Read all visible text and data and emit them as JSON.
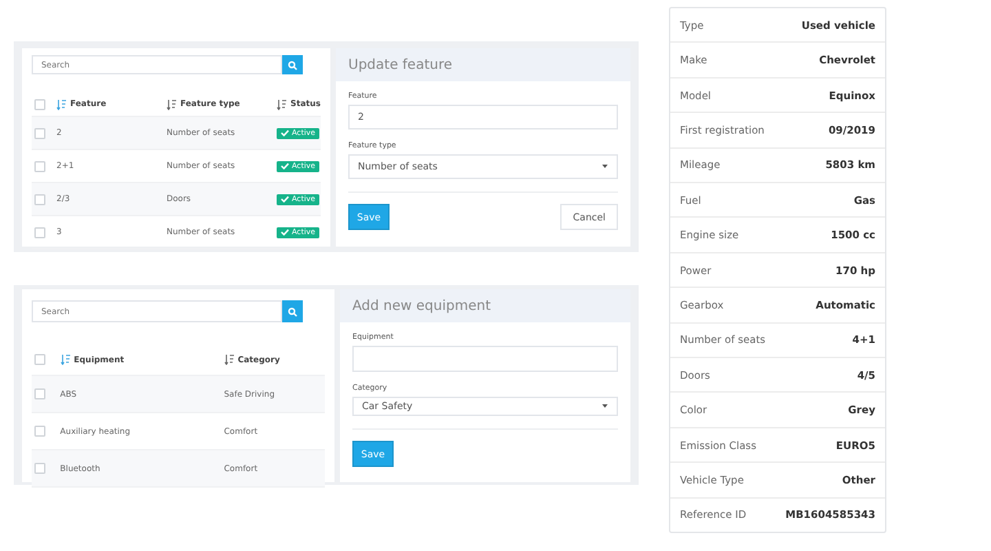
{
  "feature_panel": {
    "search": {
      "placeholder": "Search"
    },
    "select_all": {
      "checked": false
    },
    "columns": [
      {
        "label": "Feature",
        "sorted": true
      },
      {
        "label": "Feature type",
        "sorted": false
      },
      {
        "label": "Status",
        "sorted": false
      }
    ],
    "rows": [
      {
        "checked": false,
        "cells": [
          "2",
          "Number of seats"
        ],
        "status": "Active"
      },
      {
        "checked": false,
        "cells": [
          "2+1",
          "Number of seats"
        ],
        "status": "Active"
      },
      {
        "checked": false,
        "cells": [
          "2/3",
          "Doors"
        ],
        "status": "Active"
      },
      {
        "checked": false,
        "cells": [
          "3",
          "Number of seats"
        ],
        "status": "Active"
      }
    ],
    "form": {
      "title": "Update feature",
      "fields": [
        {
          "label": "Feature",
          "kind": "input",
          "value": "2"
        },
        {
          "label": "Feature type",
          "kind": "select",
          "value": "Number of seats"
        }
      ],
      "buttons": [
        {
          "label": "Save",
          "kind": "primary"
        },
        {
          "label": "Cancel",
          "kind": "secondary"
        }
      ]
    }
  },
  "equipment_panel": {
    "search": {
      "placeholder": "Search"
    },
    "select_all": {
      "checked": false
    },
    "columns": [
      {
        "label": "Equipment",
        "sorted": true
      },
      {
        "label": "Category",
        "sorted": false
      }
    ],
    "rows": [
      {
        "checked": false,
        "cells": [
          "ABS",
          "Safe Driving"
        ]
      },
      {
        "checked": false,
        "cells": [
          "Auxiliary heating",
          "Comfort"
        ]
      },
      {
        "checked": false,
        "cells": [
          "Bluetooth",
          "Comfort"
        ]
      }
    ],
    "form": {
      "title": "Add new equipment",
      "fields": [
        {
          "label": "Equipment",
          "kind": "input"
        },
        {
          "label": "Category",
          "kind": "select",
          "value": "Car Safety"
        }
      ],
      "buttons": [
        {
          "label": "Save",
          "kind": "primary"
        }
      ]
    }
  },
  "specs": [
    {
      "label": "Type",
      "value": "Used vehicle"
    },
    {
      "label": "Make",
      "value": "Chevrolet"
    },
    {
      "label": "Model",
      "value": "Equinox"
    },
    {
      "label": "First registration",
      "value": "09/2019"
    },
    {
      "label": "Mileage",
      "value": "5803 km"
    },
    {
      "label": "Fuel",
      "value": "Gas"
    },
    {
      "label": "Engine size",
      "value": "1500 cc"
    },
    {
      "label": "Power",
      "value": "170 hp"
    },
    {
      "label": "Gearbox",
      "value": "Automatic"
    },
    {
      "label": "Number of seats",
      "value": "4+1"
    },
    {
      "label": "Doors",
      "value": "4/5"
    },
    {
      "label": "Color",
      "value": "Grey"
    },
    {
      "label": "Emission Class",
      "value": "EURO5"
    },
    {
      "label": "Vehicle Type",
      "value": "Other"
    },
    {
      "label": "Reference ID",
      "value": "MB1604585343"
    }
  ]
}
